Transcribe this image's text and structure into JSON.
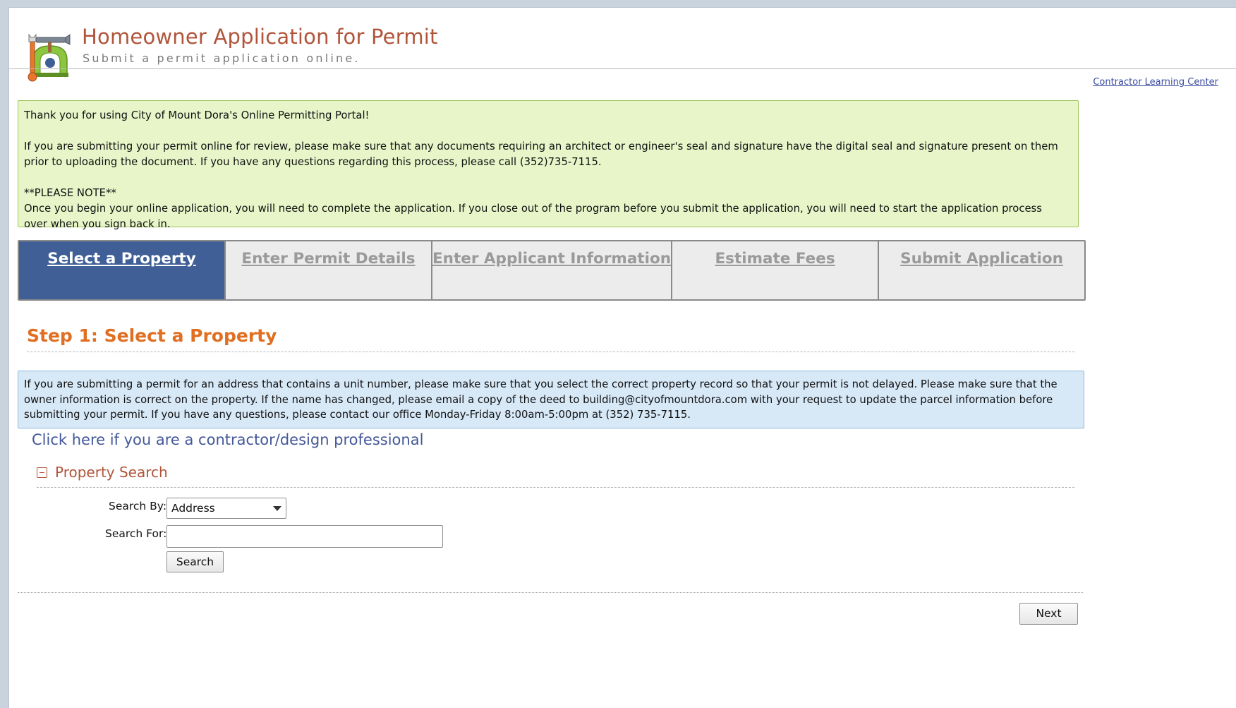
{
  "header": {
    "title": "Homeowner Application for Permit",
    "subtitle": "Submit a permit application online.",
    "learning_link": "Contractor Learning Center"
  },
  "notice": {
    "line1": "Thank you for using City of Mount Dora's Online Permitting Portal!",
    "line2": "If you are submitting your permit online for review, please make sure that any documents requiring an architect or engineer's seal and signature have the digital seal and signature present on them prior to uploading the document. If you have any questions regarding this process, please call (352)735-7115.",
    "line3": "**PLEASE NOTE**",
    "line4": "Once you begin your online application, you will need to complete the application. If you close out of the program before you submit the application, you will need to start the application process over when you sign back in."
  },
  "steps": [
    {
      "label": "Select a Property",
      "active": true
    },
    {
      "label": "Enter Permit Details",
      "active": false
    },
    {
      "label": "Enter Applicant Information",
      "active": false
    },
    {
      "label": "Estimate Fees",
      "active": false
    },
    {
      "label": "Submit Application",
      "active": false
    }
  ],
  "step_heading": "Step 1: Select a Property",
  "info": "If you are submitting a permit for an address that contains a unit number, please make sure that you select the correct property record so that your permit is not delayed. Please make sure that the owner information is correct on the property. If the name has changed, please email a copy of the deed to building@cityofmountdora.com with your request to update the parcel information before submitting your permit. If you have any questions, please contact our office Monday-Friday 8:00am-5:00pm at (352) 735-7115.",
  "contractor_link": "Click here if you are a contractor/design professional",
  "property_search": {
    "section_title": "Property Search",
    "search_by_label": "Search By:",
    "search_by_value": "Address",
    "search_for_label": "Search For:",
    "search_for_value": "",
    "search_button": "Search"
  },
  "next_button": "Next",
  "colors": {
    "title": "#b0553a",
    "step_heading": "#e06f22",
    "active_step": "#3f5f96",
    "notice_bg": "#e7f5c9",
    "info_bg": "#d7e8f7",
    "link": "#44589a"
  },
  "icons": {
    "logo": "hammer-wrench-permit-logo-icon",
    "collapse": "minus-square-icon",
    "dropdown": "chevron-down-icon"
  }
}
